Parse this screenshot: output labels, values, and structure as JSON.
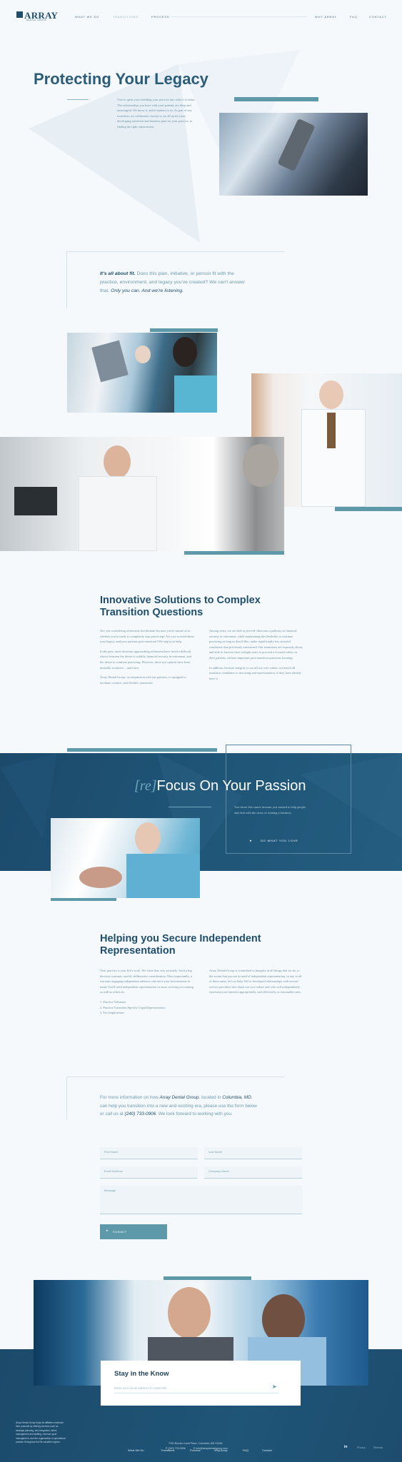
{
  "header": {
    "logo": "ARRAY",
    "logo_sub": "DENTAL GROUP",
    "nav": [
      "What We Do",
      "Transitions",
      "Process",
      "Why Array",
      "FAQ",
      "Contact"
    ]
  },
  "hero": {
    "title": "Protecting Your Legacy",
    "body": "You've spent years building your practice into what it is today. The relationships you have with your patients are deep and meaningful. We know it, and it matters to us. As part of any transition, we collaborate closely so we all arrive from developing transition and business plan for your practice, to finding the right replacement."
  },
  "quote": {
    "lead": "It's all about fit.",
    "text": " Does this plan, initiative, or person fit with the practice, environment, and legacy you've created? We can't answer that. ",
    "end": "Only you can. And we're listening."
  },
  "solutions": {
    "title": "Innovative Solutions to Complex Transition Questions",
    "col1": [
      "Are you considering retirement, but hesitant because you're unsure as to whether you're ready to completely stop practicing? Are you worried about your legacy, and your patients post-transition? We step in to help.",
      "In the past, most clinicians approaching retirement have faced a difficult choice between the desire to solidify financial security in retirement, and the desire to continue practicing. However, these two options have been mutually exclusive – until now.",
      "Array Dental Group, in conjunction with our partners, is equipped to facilitate creative, and flexible, transitions"
    ],
    "col2": [
      "Among years, we are able to provide clinicians a pathway to financial security in retirement, while maintaining the flexibility to continue practicing as long as they'd like, under significantly less stressful conditions than previously envisioned. Our transitions are expressly about, and able to forecast their twilight years to proceed a focused solely on their patients, without important post-transition questions looming.",
      "In addition, because integrity is our all-out core values, we match all transition candidates to invoicing and representation, if they have already have it"
    ]
  },
  "passion": {
    "prefix": "[re]",
    "title": "Focus On Your Passion",
    "body": "You chose this career because you wanted to help people and deal with the stress of running a business.",
    "cta": "Do What You Love"
  },
  "independent": {
    "title": "Helping you Secure Independent Representation",
    "col1": "Your practice is your life's work. We value that very seriously. Such a big decision warrants careful, deliberative consideration. Most importantly, it warrants engaging independent advisors who have your best interests in mind. You'll need independent representation in areas covering accounting, as well as others in:",
    "list": [
      "1. Practice Valuation",
      "2. Practice Transition Specific Legal Representation",
      "3. Tax Implications"
    ],
    "col2": "Array Dental Group is committed to integrity in all things that we do, to the extent that you are in need of independent representation, in any or all of these areas, let's us help. We've developed relationships with several service providers who share our core values and who will independently represent your interests appropriately, and effectively, at reasonable rates."
  },
  "contact": {
    "pre": "For more information on how ",
    "company": "Array Dental Group",
    "mid": ", located in ",
    "city": "Columbia, MD",
    "post": ", can help you transition into a new and exciting era, please use the form below or call us at ",
    "phone": "(240) 733-0906",
    "end": ". We look forward to working with you.",
    "fields": [
      "First Name",
      "Last Name",
      "Email Address",
      "Company Name",
      "Message"
    ],
    "submit": "Submit"
  },
  "newsletter": {
    "title": "Stay in the Know",
    "placeholder": "Enter your email address to subscribe"
  },
  "footer": {
    "blurb": "Array Dental Group helps its affiliates maximize their potential by offering services such as strategic planning, and integration, talent management and staffing, revenue cycle management, and the organization of operational practice throughout the life-valuable regions.",
    "links": [
      "What We Do",
      "Transitions",
      "Process",
      "Why Array",
      "FAQ",
      "Contact"
    ],
    "address": "7151 Bordon Land Place, Columbia, MD 21046",
    "phone": "P (240) 733-0906",
    "email": "E info@arraydentalgroup.com",
    "legal": [
      "Privacy",
      "Sitemap"
    ],
    "social": "in"
  },
  "colors": {
    "navy": "#1e4e6c",
    "teal": "#5d99a8",
    "band": "#1f4f71"
  }
}
